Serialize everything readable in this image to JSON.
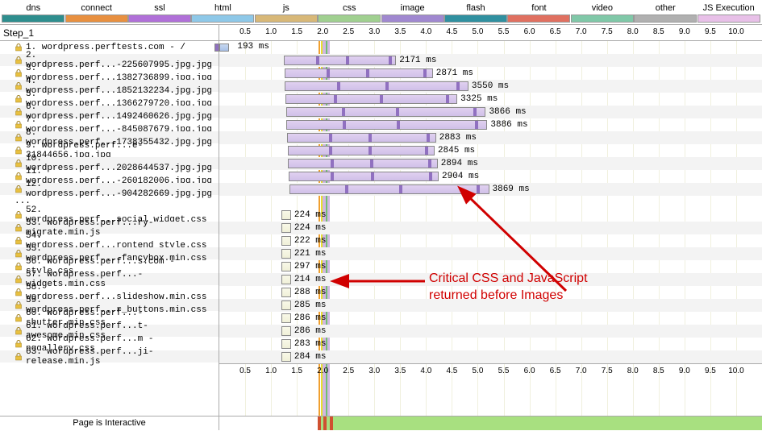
{
  "legend": [
    {
      "label": "dns",
      "color": "#2e8e8e"
    },
    {
      "label": "connect",
      "color": "#e89040"
    },
    {
      "label": "ssl",
      "color": "#b070d8"
    },
    {
      "label": "html",
      "color": "#8ec8e8"
    },
    {
      "label": "js",
      "color": "#d8b878"
    },
    {
      "label": "css",
      "color": "#a0d090"
    },
    {
      "label": "image",
      "color": "#a088d0"
    },
    {
      "label": "flash",
      "color": "#3090a0"
    },
    {
      "label": "font",
      "color": "#e07060"
    },
    {
      "label": "video",
      "color": "#80c8a8"
    },
    {
      "label": "other",
      "color": "#b0b0b0"
    },
    {
      "label": "JS Execution",
      "color": "#e8c0e8"
    }
  ],
  "step_label": "Step_1",
  "ticks": [
    "0.5",
    "1.0",
    "1.5",
    "2.0",
    "2.5",
    "3.0",
    "3.5",
    "4.0",
    "4.5",
    "5.0",
    "5.5",
    "6.0",
    "6.5",
    "7.0",
    "7.5",
    "8.0",
    "8.5",
    "9.0",
    "9.5",
    "10.0"
  ],
  "timeline_max": 10500,
  "markers": {
    "purple_ms": 2000,
    "orange_ms": 1920,
    "yellow_ms": 1970,
    "green_ms": 2060
  },
  "rows_top": [
    {
      "n": "1",
      "name": "wordpress.perftests.com - /",
      "type": "first",
      "start": 0,
      "dur": 193,
      "time": "193 ms"
    },
    {
      "n": "2",
      "name": "wordpress.perf...-225607995.jpg.jpg",
      "type": "img",
      "start": 1250,
      "dur": 2171,
      "time": "2171 ms"
    },
    {
      "n": "3",
      "name": "wordpress.perf...1382736899.jpg.jpg",
      "type": "img",
      "start": 1260,
      "dur": 2871,
      "time": "2871 ms"
    },
    {
      "n": "4",
      "name": "wordpress.perf...1852132234.jpg.jpg",
      "type": "img",
      "start": 1270,
      "dur": 3550,
      "time": "3550 ms"
    },
    {
      "n": "5",
      "name": "wordpress.perf...1366279720.jpg.jpg",
      "type": "img",
      "start": 1280,
      "dur": 3325,
      "time": "3325 ms"
    },
    {
      "n": "6",
      "name": "wordpress.perf...1492460626.jpg.jpg",
      "type": "img",
      "start": 1290,
      "dur": 3866,
      "time": "3866 ms"
    },
    {
      "n": "7",
      "name": "wordpress.perf...-845087679.jpg.jpg",
      "type": "img",
      "start": 1300,
      "dur": 3886,
      "time": "3886 ms"
    },
    {
      "n": "8",
      "name": "wordpress.perf...1738355432.jpg.jpg",
      "type": "img",
      "start": 1310,
      "dur": 2883,
      "time": "2883 ms"
    },
    {
      "n": "9",
      "name": "wordpress.perf...e-31844656.jpg.jpg",
      "type": "img",
      "start": 1320,
      "dur": 2845,
      "time": "2845 ms"
    },
    {
      "n": "10",
      "name": "wordpress.perf...2028644537.jpg.jpg",
      "type": "img",
      "start": 1330,
      "dur": 2894,
      "time": "2894 ms"
    },
    {
      "n": "11",
      "name": "wordpress.perf...-260182006.jpg.jpg",
      "type": "img",
      "start": 1340,
      "dur": 2904,
      "time": "2904 ms"
    },
    {
      "n": "12",
      "name": "wordpress.perf...-904282669.jpg.jpg",
      "type": "img",
      "start": 1350,
      "dur": 3869,
      "time": "3869 ms"
    }
  ],
  "dots": "...",
  "rows_bottom": [
    {
      "n": "52",
      "name": "wordpress.perf...social_widget.css",
      "type": "css",
      "start": 1200,
      "dur": 224,
      "time": "224 ms"
    },
    {
      "n": "53",
      "name": "wordpress.perf...ry-migrate.min.js",
      "type": "css",
      "start": 1200,
      "dur": 224,
      "time": "224 ms"
    },
    {
      "n": "54",
      "name": "wordpress.perf...rontend_style.css",
      "type": "css",
      "start": 1200,
      "dur": 222,
      "time": "222 ms"
    },
    {
      "n": "55",
      "name": "wordpress.perf....fancybox.min.css",
      "type": "css",
      "start": 1200,
      "dur": 221,
      "time": "221 ms"
    },
    {
      "n": "56",
      "name": "wordpress.perf...s.com - style.css",
      "type": "css",
      "start": 1200,
      "dur": 297,
      "time": "297 ms"
    },
    {
      "n": "57",
      "name": "wordpress.perf...- widgets.min.css",
      "type": "css",
      "start": 1200,
      "dur": 214,
      "time": "214 ms"
    },
    {
      "n": "58",
      "name": "wordpress.perf...slideshow.min.css",
      "type": "css",
      "start": 1200,
      "dur": 288,
      "time": "288 ms"
    },
    {
      "n": "59",
      "name": "wordpress.perf...r_buttons.min.css",
      "type": "css",
      "start": 1200,
      "dur": 285,
      "time": "285 ms"
    },
    {
      "n": "60",
      "name": "wordpress.perf...- shutter.min.css",
      "type": "css",
      "start": 1200,
      "dur": 286,
      "time": "286 ms"
    },
    {
      "n": "61",
      "name": "wordpress.perf...t-awesome.min.css",
      "type": "css",
      "start": 1200,
      "dur": 286,
      "time": "286 ms"
    },
    {
      "n": "62",
      "name": "wordpress.perf...m - nggallery.css",
      "type": "css",
      "start": 1200,
      "dur": 283,
      "time": "283 ms"
    },
    {
      "n": "63",
      "name": "wordpress.perf...ji-release.min.js",
      "type": "css",
      "start": 1200,
      "dur": 284,
      "time": "284 ms"
    }
  ],
  "status_label": "Page is Interactive",
  "status_segments": [
    {
      "start": 0,
      "end": 1900,
      "color": "#ffffff"
    },
    {
      "start": 1900,
      "end": 1960,
      "color": "#d05030"
    },
    {
      "start": 1960,
      "end": 2010,
      "color": "#a8e080"
    },
    {
      "start": 2010,
      "end": 2080,
      "color": "#d05030"
    },
    {
      "start": 2080,
      "end": 2140,
      "color": "#a8e080"
    },
    {
      "start": 2140,
      "end": 2200,
      "color": "#d05030"
    }
  ],
  "annotation": {
    "line1": "Critical CSS and JavaScript",
    "line2": "returned before Images"
  }
}
